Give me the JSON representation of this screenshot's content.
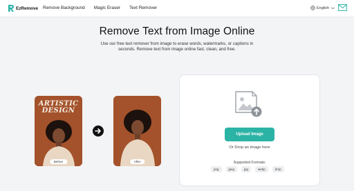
{
  "brand": {
    "name": "EzRemove",
    "accent": "#2bb3a5"
  },
  "nav": {
    "items": [
      "Remove Background",
      "Magic Eraser",
      "Text Remover"
    ]
  },
  "language": {
    "label": "English"
  },
  "hero": {
    "title": "Remove Text from Image Online",
    "subtitle": "Use our free text remover from image to erase words, watermarks, or captions in seconds. Remove text from image online fast, clean, and free."
  },
  "samples": {
    "before_overlay_line1": "ARTISTIC",
    "before_overlay_line2": "DESIGN",
    "before_label": "Before",
    "after_label": "After"
  },
  "upload": {
    "button_label": "Upload Image",
    "drop_text": "Or Drop an image here",
    "formats_label": "Supported Formats:",
    "formats": [
      "png",
      "jpeg",
      "jpg",
      "webp",
      "bmp"
    ]
  }
}
